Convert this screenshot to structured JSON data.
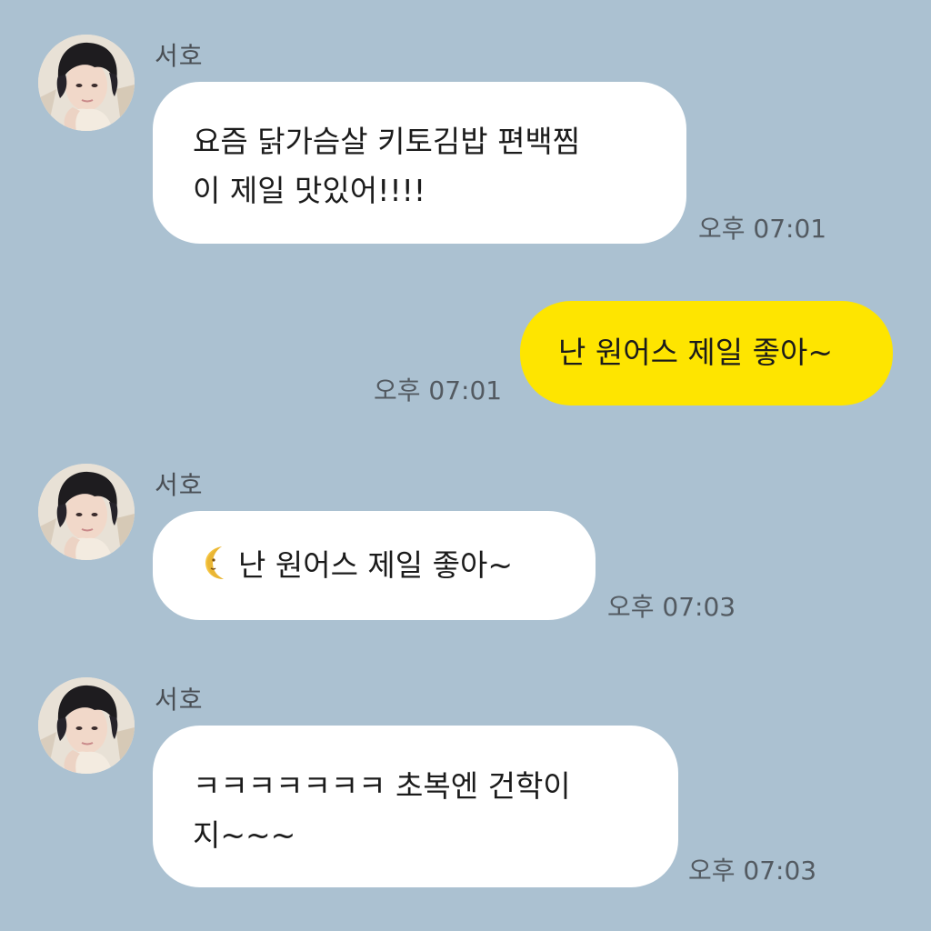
{
  "messages": [
    {
      "sender": "서호",
      "avatar_icon": "profile-photo-avatar",
      "lines": [
        "요즘 닭가슴살 키토김밥 편백찜",
        "이 제일 맛있어!!!!"
      ],
      "time": "오후 07:01"
    },
    {
      "sender": "me",
      "text": "난 원어스 제일 좋아~",
      "time": "오후 07:01"
    },
    {
      "sender": "서호",
      "avatar_icon": "profile-photo-avatar",
      "emoji_icon": "moon-face-icon",
      "text": "난 원어스 제일 좋아~",
      "time": "오후 07:03"
    },
    {
      "sender": "서호",
      "avatar_icon": "profile-photo-avatar",
      "lines": [
        "ㅋㅋㅋㅋㅋㅋㅋ 초복엔 건학이",
        "지~~~"
      ],
      "time": "오후 07:03"
    }
  ],
  "colors": {
    "background": "#abc1d1",
    "incoming_bubble": "#ffffff",
    "outgoing_bubble": "#fee500",
    "time_text": "#535a61"
  }
}
